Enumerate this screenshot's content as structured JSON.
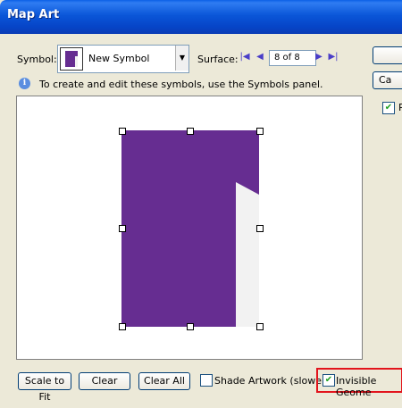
{
  "window": {
    "title": "Map Art"
  },
  "symbol": {
    "label": "Symbol:",
    "selected": "New Symbol"
  },
  "surface": {
    "label": "Surface:",
    "value": "8 of 8"
  },
  "info": {
    "text": "To create and edit these symbols, use the Symbols panel."
  },
  "right_panel": {
    "button_1": "",
    "button_2": "Ca",
    "checkbox_label": "P",
    "checkbox_checked": true
  },
  "buttons": {
    "scale_to_fit": "Scale to Fit",
    "clear": "Clear",
    "clear_all": "Clear All"
  },
  "options": {
    "shade_artwork": {
      "label": "Shade Artwork (slower)",
      "checked": false
    },
    "invisible_geometry": {
      "label": "Invisible Geome",
      "checked": true
    }
  },
  "colors": {
    "art_fill": "#662d91",
    "highlight": "#e2141c"
  },
  "icons": {
    "first": "first-surface-icon",
    "prev": "previous-surface-icon",
    "next": "next-surface-icon",
    "last": "last-surface-icon",
    "info": "info-icon"
  }
}
